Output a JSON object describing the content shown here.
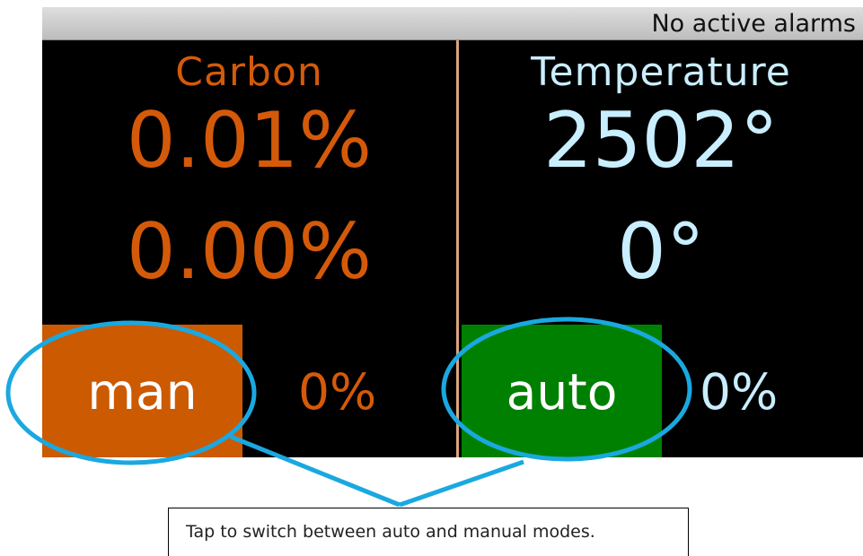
{
  "status_bar": {
    "alarm_text": "No active alarms"
  },
  "panels": [
    {
      "title": "Carbon",
      "value_primary": "0.01%",
      "value_secondary": "0.00%",
      "mode_label": "man",
      "output_value": "0%",
      "text_color": "#d45a0a",
      "button_color": "#cc5a00"
    },
    {
      "title": "Temperature",
      "value_primary": "2502°",
      "value_secondary": "0°",
      "mode_label": "auto",
      "output_value": "0%",
      "text_color": "#c9eeff",
      "button_color": "#008000"
    }
  ],
  "annotation": {
    "callout_text": "Tap to switch between auto and manual modes.",
    "highlight_color": "#1aa8e0"
  }
}
